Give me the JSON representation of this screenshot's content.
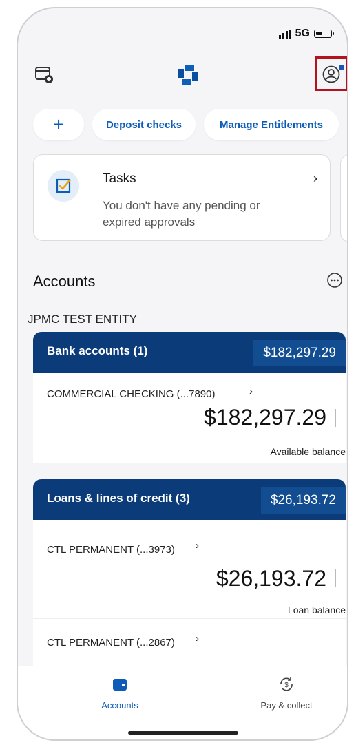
{
  "status_bar": {
    "network": "5G"
  },
  "header": {
    "add_wallet_icon": "wallet-add-icon",
    "logo_icon": "chase-octagon-icon",
    "profile_icon": "profile-icon",
    "accent": "#1a56b8",
    "highlight_color": "#b5121b"
  },
  "quick_actions": {
    "add_label": "+",
    "deposit_label": "Deposit checks",
    "entitlements_label": "Manage Entitlements"
  },
  "tasks": {
    "title": "Tasks",
    "message": "You don't have any pending or expired approvals"
  },
  "accounts": {
    "heading": "Accounts",
    "entity": "JPMC TEST ENTITY",
    "bank": {
      "label": "Bank accounts (1)",
      "total": "$182,297.29",
      "items": [
        {
          "name": "COMMERCIAL CHECKING (...7890)",
          "balance": "$182,297.29",
          "balance_label": "Available balance"
        }
      ]
    },
    "loans": {
      "label": "Loans & lines of credit (3)",
      "total": "$26,193.72",
      "items": [
        {
          "name": "CTL PERMANENT (...3973)",
          "balance": "$26,193.72",
          "balance_label": "Loan balance"
        },
        {
          "name": "CTL PERMANENT (...2867)"
        }
      ]
    }
  },
  "tabbar": {
    "accounts_label": "Accounts",
    "pay_label": "Pay & collect"
  }
}
